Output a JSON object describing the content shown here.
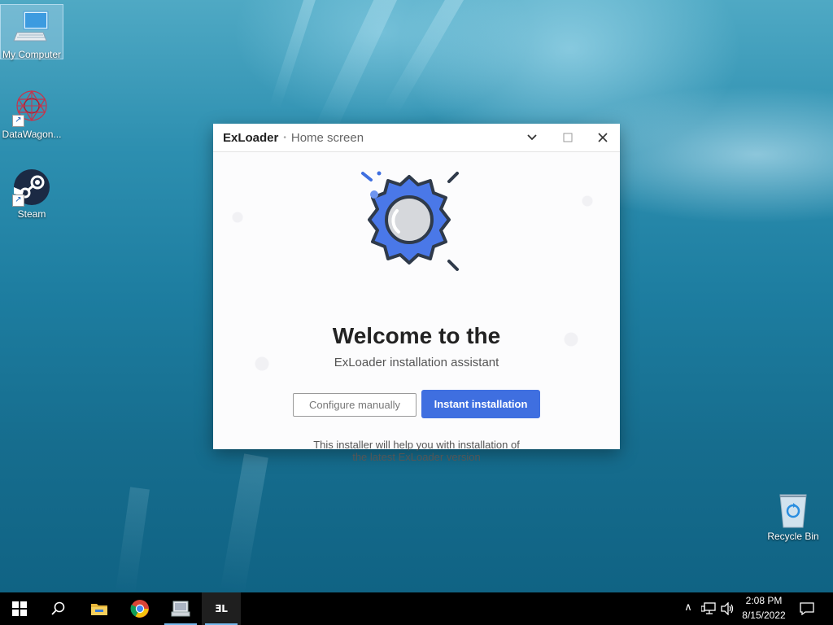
{
  "desktop": {
    "icons": [
      {
        "label": "My Computer"
      },
      {
        "label": "DataWagon..."
      },
      {
        "label": "Steam"
      },
      {
        "label": "Recycle Bin"
      }
    ]
  },
  "window": {
    "app_name": "ExLoader",
    "separator": "•",
    "screen_name": "Home screen",
    "controls": {
      "dropdown": "⌄",
      "maximize": "☐",
      "close": "✕"
    },
    "title": "Welcome to the",
    "subtitle": "ExLoader installation assistant",
    "configure_button": "Configure manually",
    "instant_button": "Instant installation",
    "info_line1": "This installer will help you with installation of",
    "info_line2": "the latest ExLoader version",
    "colors": {
      "accent": "#3f6fe0",
      "logo_blue": "#4a78e8",
      "logo_dark": "#2f3a4a"
    }
  },
  "taskbar": {
    "items": [
      {
        "name": "start-button",
        "icon": "windows-icon"
      },
      {
        "name": "search-button",
        "icon": "search-icon"
      },
      {
        "name": "file-explorer",
        "icon": "folder-icon"
      },
      {
        "name": "chrome",
        "icon": "chrome-icon"
      },
      {
        "name": "app-window",
        "icon": "app-icon"
      },
      {
        "name": "exloader-task",
        "icon": "exloader-icon",
        "text": "ƎL"
      }
    ],
    "tray": {
      "chevron": "∧",
      "time": "2:08 PM",
      "date": "8/15/2022"
    }
  }
}
